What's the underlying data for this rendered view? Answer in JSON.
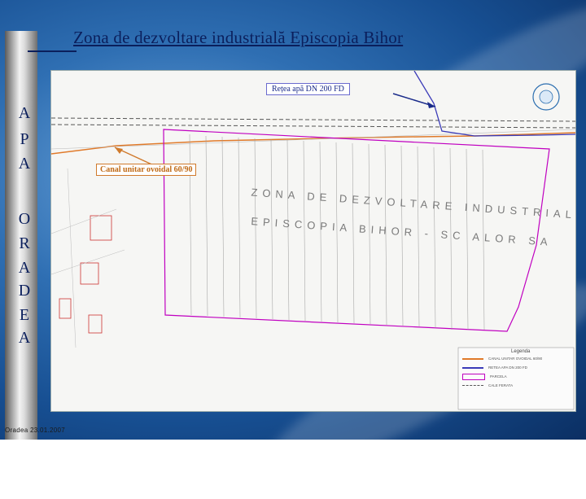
{
  "slide": {
    "title": "Zona de dezvoltare industrială Episcopia Bihor",
    "side_letters": [
      "A",
      "P",
      "A",
      "O",
      "R",
      "A",
      "D",
      "E",
      "A"
    ],
    "date": "Oradea 23.01.2007"
  },
  "map": {
    "callouts": {
      "water": "Rețea apă DN 200 FD",
      "sewer": "Canal unitar ovoidal 60/90"
    },
    "zone_label_line1": "ZONA DE DEZVOLTARE INDUSTRIALA",
    "zone_label_line2": "EPISCOPIA BIHOR - SC ALOR SA",
    "legend": {
      "title": "Legenda",
      "items": [
        {
          "label": "CANAL UNITAR OVOIDAL 60/90",
          "color": "#e07a2a",
          "style": "solid"
        },
        {
          "label": "RETEA APA DN 200 FD",
          "color": "#3b3bb8",
          "style": "solid"
        },
        {
          "label": "PARCELA",
          "color": "#c000c0",
          "style": "solid"
        },
        {
          "label": "CALE FERATA",
          "color": "#555555",
          "style": "dashed"
        }
      ]
    },
    "colors": {
      "sewer": "#e07a2a",
      "water": "#3b3bb8",
      "parcel": "#c000c0",
      "railway": "#555555"
    }
  }
}
